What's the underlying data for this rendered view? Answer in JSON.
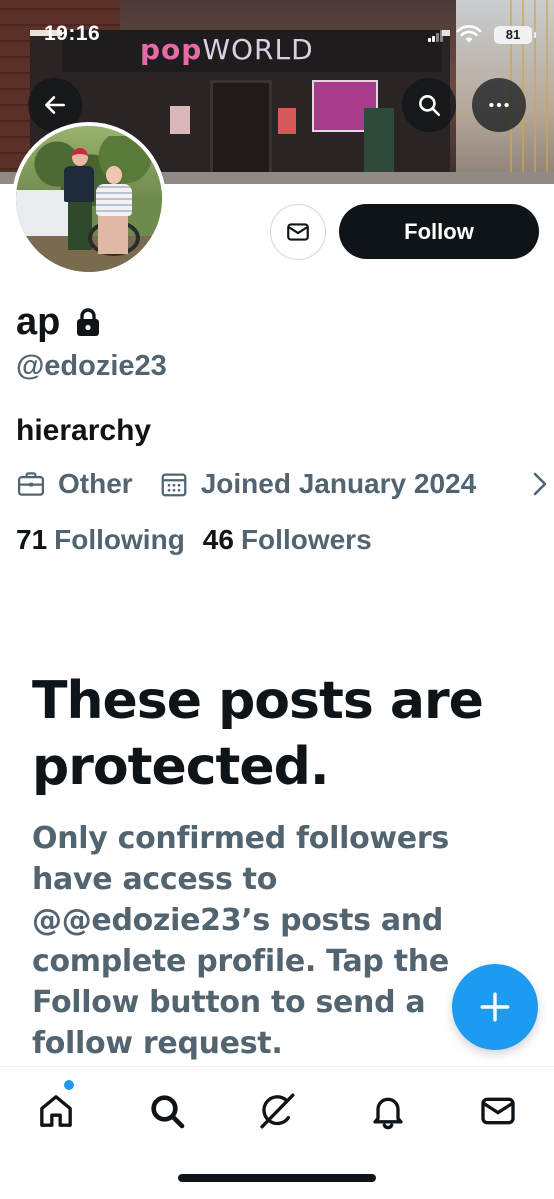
{
  "status_bar": {
    "time": "19:16",
    "battery": "81"
  },
  "banner": {
    "brand_pop": "pop",
    "brand_world": "WORLD"
  },
  "header": {
    "icons": [
      "back-arrow-icon",
      "search-icon",
      "more-icon"
    ]
  },
  "actions": {
    "follow_label": "Follow",
    "message_icon": "envelope-icon"
  },
  "profile": {
    "display_name": "ap",
    "handle": "@edozie23",
    "bio": "hierarchy",
    "category": "Other",
    "joined": "Joined January 2024",
    "following_count": "71",
    "following_label": "Following",
    "followers_count": "46",
    "followers_label": "Followers"
  },
  "protected_notice": {
    "title": "These posts are protected.",
    "body": "Only confirmed followers have access to @@edozie23’s posts and complete profile. Tap the Follow button to send a follow request."
  },
  "fab": {
    "icon": "plus-icon"
  },
  "bottom_nav": {
    "items": [
      "home-icon",
      "search-icon",
      "grok-icon",
      "notifications-icon",
      "messages-icon"
    ],
    "unread_dot_color": "#1d9bf0"
  },
  "colors": {
    "accent": "#1d9bf0",
    "text_primary": "#0f1419",
    "text_secondary": "#536471",
    "follow_button_bg": "#0f1419"
  }
}
